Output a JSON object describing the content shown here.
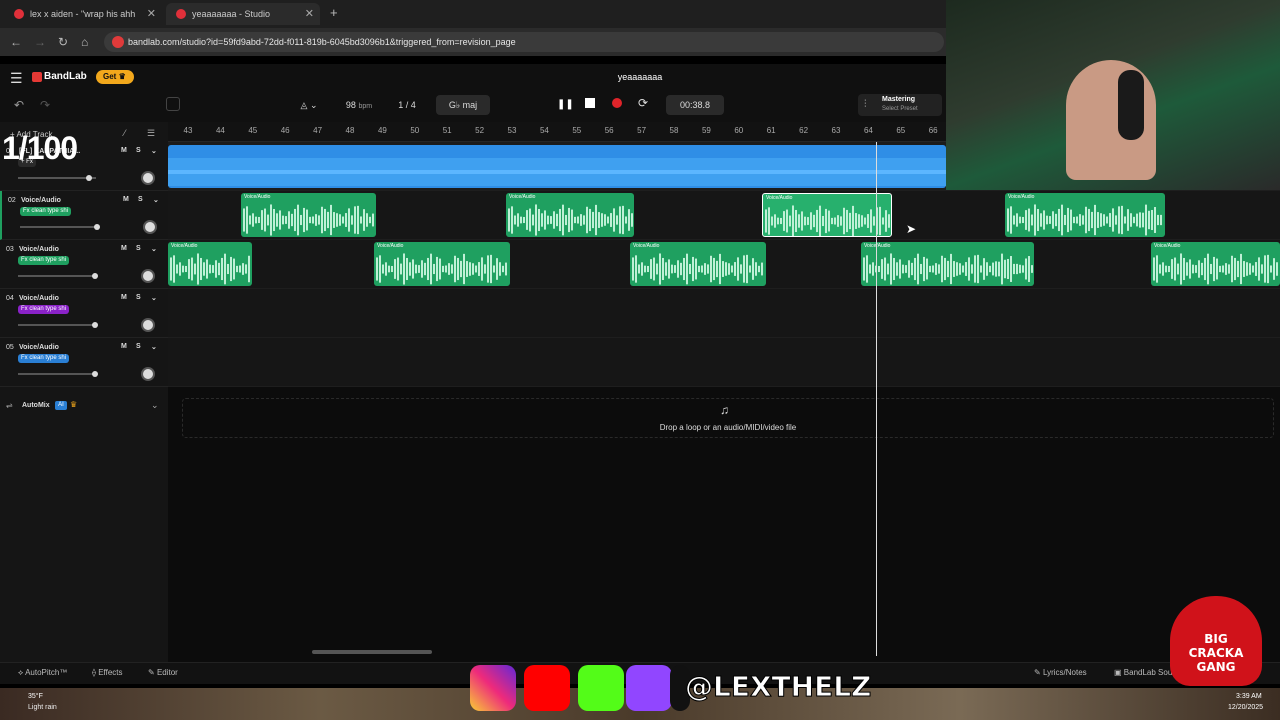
{
  "browser": {
    "tabs": [
      {
        "title": "lex x aiden - \"wrap his ahh"
      },
      {
        "title": "yeaaaaaaa - Studio"
      }
    ],
    "new_tab": "+",
    "url": "bandlab.com/studio?id=59fd9abd-72dd-f011-819b-6045bd3096b1&triggered_from=revision_page"
  },
  "app": {
    "brand": "BandLab",
    "get_label": "Get",
    "project_title": "yeaaaaaaa"
  },
  "toolbar": {
    "bpm": "98",
    "bpm_unit": "bpm",
    "time_sig": "1 / 4",
    "key": "G♭ maj",
    "time": "00:38.8",
    "mastering_label": "Mastering",
    "mastering_sub": "Select Preset"
  },
  "track_header": {
    "add_track": "Add Track"
  },
  "ruler": [
    "43",
    "44",
    "45",
    "46",
    "47",
    "48",
    "49",
    "50",
    "51",
    "52",
    "53",
    "54",
    "55",
    "56",
    "57",
    "58",
    "59",
    "60",
    "61",
    "62",
    "63",
    "64",
    "65",
    "66"
  ],
  "tracks": [
    {
      "num": "01",
      "name": "[FL] KARPATHIA...",
      "fx": "+ Fx",
      "fx_color": "#2a2a2a"
    },
    {
      "num": "02",
      "name": "Voice/Audio",
      "fx": "Fx clean type shi",
      "fx_color": "#1fa060"
    },
    {
      "num": "03",
      "name": "Voice/Audio",
      "fx": "Fx clean type shi",
      "fx_color": "#1fa060"
    },
    {
      "num": "04",
      "name": "Voice/Audio",
      "fx": "Fx clean type shi",
      "fx_color": "#8a22c8"
    },
    {
      "num": "05",
      "name": "Voice/Audio",
      "fx": "Fx clean type shi",
      "fx_color": "#2a7fd4"
    }
  ],
  "clip_label": "Voice/Audio",
  "automix": {
    "label": "AutoMix",
    "badge": "AI"
  },
  "dropzone": {
    "text": "Drop a loop or an audio/MIDI/video file"
  },
  "bottom": {
    "autopitch": "AutoPitch™",
    "effects": "Effects",
    "editor": "Editor",
    "lyrics": "Lyrics/Notes",
    "sounds": "BandLab Sounds"
  },
  "overlay": {
    "counter": "1/100",
    "handle": "@LEXTHELZ",
    "mascot_line1": "BIG",
    "mascot_line2": "CRACKA",
    "mascot_line3": "GANG"
  },
  "taskbar": {
    "weather_temp": "35°F",
    "weather_desc": "Light rain",
    "clock_time": "3:39 AM",
    "clock_date": "12/20/2025"
  }
}
